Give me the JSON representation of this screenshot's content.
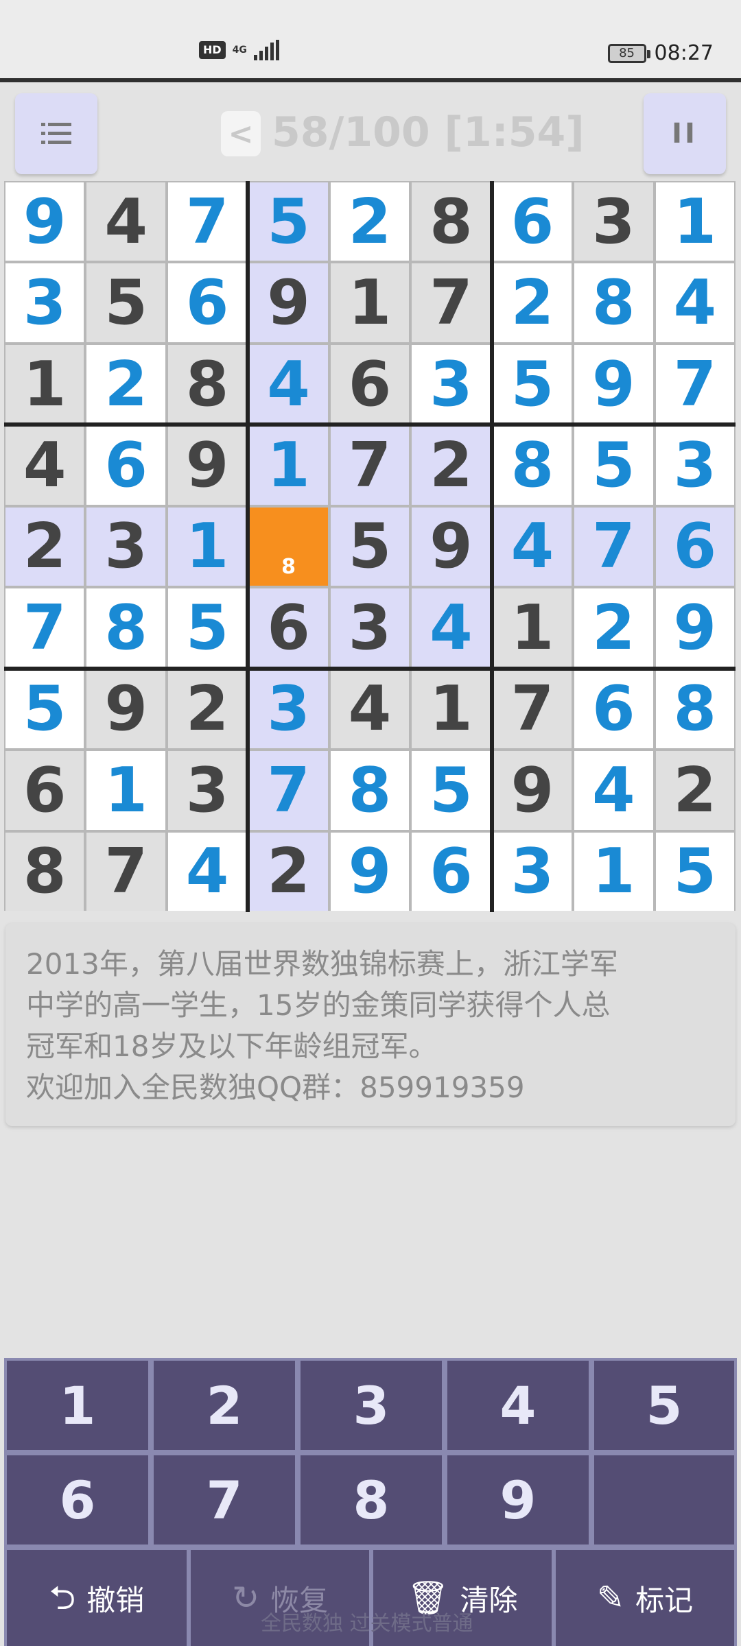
{
  "status_bar": {
    "hd": "HD",
    "network": "4G",
    "battery": "85",
    "time": "08:27"
  },
  "header": {
    "menu_icon": "menu-icon",
    "prev_label": "<",
    "level_progress": "58/100",
    "timer": "[1:54]",
    "pause_label": "II"
  },
  "board": {
    "rows": [
      [
        9,
        4,
        7,
        5,
        2,
        8,
        6,
        3,
        1
      ],
      [
        3,
        5,
        6,
        9,
        1,
        7,
        2,
        8,
        4
      ],
      [
        1,
        2,
        8,
        4,
        6,
        3,
        5,
        9,
        7
      ],
      [
        4,
        6,
        9,
        1,
        7,
        2,
        8,
        5,
        3
      ],
      [
        2,
        3,
        1,
        0,
        5,
        9,
        4,
        7,
        6
      ],
      [
        7,
        8,
        5,
        6,
        3,
        4,
        1,
        2,
        9
      ],
      [
        5,
        9,
        2,
        3,
        4,
        1,
        7,
        6,
        8
      ],
      [
        6,
        1,
        3,
        7,
        8,
        5,
        9,
        4,
        2
      ],
      [
        8,
        7,
        4,
        2,
        9,
        6,
        3,
        1,
        5
      ]
    ],
    "given": [
      [
        0,
        1,
        0,
        0,
        0,
        1,
        0,
        1,
        0
      ],
      [
        0,
        1,
        0,
        1,
        1,
        1,
        0,
        0,
        0
      ],
      [
        1,
        0,
        1,
        0,
        1,
        0,
        0,
        0,
        0
      ],
      [
        1,
        0,
        1,
        0,
        1,
        1,
        0,
        0,
        0
      ],
      [
        1,
        1,
        0,
        0,
        1,
        1,
        0,
        0,
        0
      ],
      [
        0,
        0,
        0,
        1,
        1,
        0,
        1,
        0,
        0
      ],
      [
        0,
        1,
        1,
        0,
        1,
        1,
        1,
        0,
        0
      ],
      [
        1,
        0,
        1,
        0,
        0,
        0,
        1,
        0,
        1
      ],
      [
        1,
        1,
        0,
        1,
        0,
        0,
        0,
        0,
        0
      ]
    ],
    "selected": {
      "row": 4,
      "col": 3,
      "note": "8"
    },
    "colors": {
      "given_text": "#444444",
      "user_text": "#1a8ad4",
      "given_bg": "#e0e0e0",
      "empty_bg": "#ffffff",
      "highlight_bg": "#dcdcf8",
      "selected_bg": "#f78f1e"
    }
  },
  "tip": {
    "lines": [
      "2013年，第八届世界数独锦标赛上，浙江学军",
      "中学的高一学生，15岁的金策同学获得个人总",
      "冠军和18岁及以下年龄组冠军。",
      "欢迎加入全民数独QQ群：859919359"
    ]
  },
  "keypad": {
    "digits": [
      "1",
      "2",
      "3",
      "4",
      "5",
      "6",
      "7",
      "8",
      "9"
    ],
    "actions": [
      {
        "label": "撤销",
        "icon": "undo-icon",
        "glyph": "⮌",
        "enabled": true
      },
      {
        "label": "恢复",
        "icon": "redo-icon",
        "glyph": "↻",
        "enabled": false
      },
      {
        "label": "清除",
        "icon": "clear-icon",
        "glyph": "🗑",
        "enabled": true
      },
      {
        "label": "标记",
        "icon": "pencil-icon",
        "glyph": "✎",
        "enabled": true
      }
    ],
    "footer": "全民数独 过关模式普通"
  }
}
